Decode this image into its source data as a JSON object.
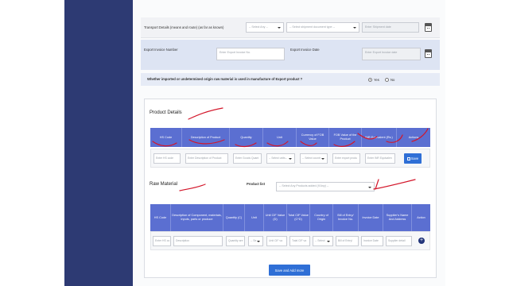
{
  "transport": {
    "label": "Transport Details (means and route) (as far as known)",
    "select_any": "-- Select Any --",
    "shipment_doc": "-- Select shipment document type --",
    "shipment_date_placeholder": "Enter Shipment date"
  },
  "export_invoice": {
    "number_label": "Export Invoice Number",
    "number_placeholder": "Enter Export Invoice No.",
    "date_label": "Export Invoice Date",
    "date_placeholder": "Enter Export Invoice date"
  },
  "question": {
    "text": "Whether imported or undetermined origin raw material is used in manufacture of Export product ?",
    "yes": "Yes",
    "no": "No"
  },
  "product_details": {
    "title": "Product Details",
    "columns": [
      "HS Code",
      "Description of Product",
      "Quantity",
      "Unit",
      "Currency of FOB Value",
      "FOB Value of the Product",
      "INR Equivalent (Rs.)",
      "Actions"
    ],
    "inputs": [
      "Enter HS code",
      "Enter Description of Product",
      "Enter Goods Quant",
      "-- Select units--",
      "-- Select countr",
      "Enter export produ",
      "Enter INR Equivalen"
    ],
    "save_label": "Save"
  },
  "raw_material": {
    "title": "Raw Material",
    "product_list_label": "Product list",
    "product_list_value": "-- Select Any Products added (If Any) --",
    "columns": [
      "HS Code",
      "Description of Component, materials, inputs, parts or produce",
      "Quantity (C)",
      "Unit",
      "Unit CIF Value (D)",
      "Total CIF Value (C*D)",
      "Country of Origin",
      "Bill of Entry/ Invoice No.",
      "Invoice Date",
      "Supplier's Name And Address",
      "Action"
    ],
    "inputs": [
      "Enter HS co",
      "Description",
      "Quantity are",
      "-- Se",
      "Unit CIF va",
      "Total CIF va",
      "-- Select",
      "Bill of Entry/",
      "Invoice Date",
      "Supplier detail"
    ]
  },
  "save_add_more_label": "Save and Add more",
  "colors": {
    "sidebar": "#2d3a73",
    "table_header": "#5b6fd1",
    "button": "#2f6fd6",
    "annotation_ink": "#d3162a"
  },
  "icons": [
    "calendar-icon",
    "chevron-down-icon",
    "save-icon",
    "plus-circle-icon"
  ]
}
